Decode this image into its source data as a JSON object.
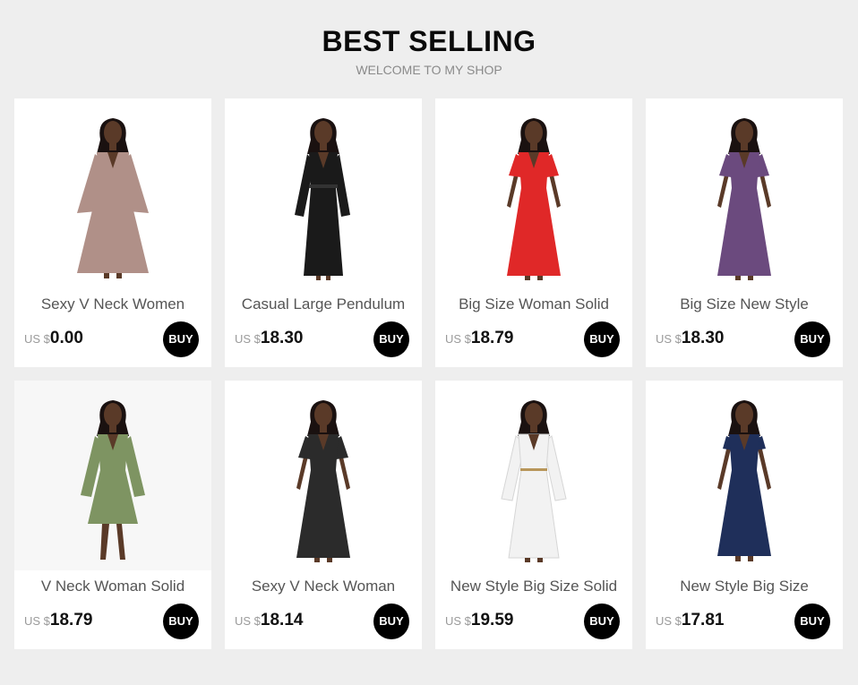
{
  "header": {
    "title": "BEST SELLING",
    "subtitle": "WELCOME TO MY SHOP"
  },
  "products": [
    {
      "name": "Sexy V Neck Women",
      "currency": "US $",
      "price": "0.00",
      "buy_label": "BUY",
      "color": "#b09088",
      "style": "flare-maxi"
    },
    {
      "name": "Casual Large Pendulum",
      "currency": "US $",
      "price": "18.30",
      "buy_label": "BUY",
      "color": "#1a1a1a",
      "style": "wrap-maxi"
    },
    {
      "name": "Big Size Woman Solid",
      "currency": "US $",
      "price": "18.79",
      "buy_label": "BUY",
      "color": "#e02828",
      "style": "short-sleeve-maxi"
    },
    {
      "name": "Big Size New Style",
      "currency": "US $",
      "price": "18.30",
      "buy_label": "BUY",
      "color": "#6b4a7e",
      "style": "short-sleeve-maxi"
    },
    {
      "name": "V Neck Woman Solid",
      "currency": "US $",
      "price": "18.79",
      "buy_label": "BUY",
      "color": "#7e9462",
      "style": "midi-wrap"
    },
    {
      "name": "Sexy V Neck Woman",
      "currency": "US $",
      "price": "18.14",
      "buy_label": "BUY",
      "color": "#2b2b2b",
      "style": "short-sleeve-maxi"
    },
    {
      "name": "New Style Big Size Solid",
      "currency": "US $",
      "price": "19.59",
      "buy_label": "BUY",
      "color": "#f2f2f2",
      "style": "long-sleeve-maxi"
    },
    {
      "name": "New Style Big Size",
      "currency": "US $",
      "price": "17.81",
      "buy_label": "BUY",
      "color": "#1f2f5a",
      "style": "sleeveless-maxi"
    }
  ]
}
